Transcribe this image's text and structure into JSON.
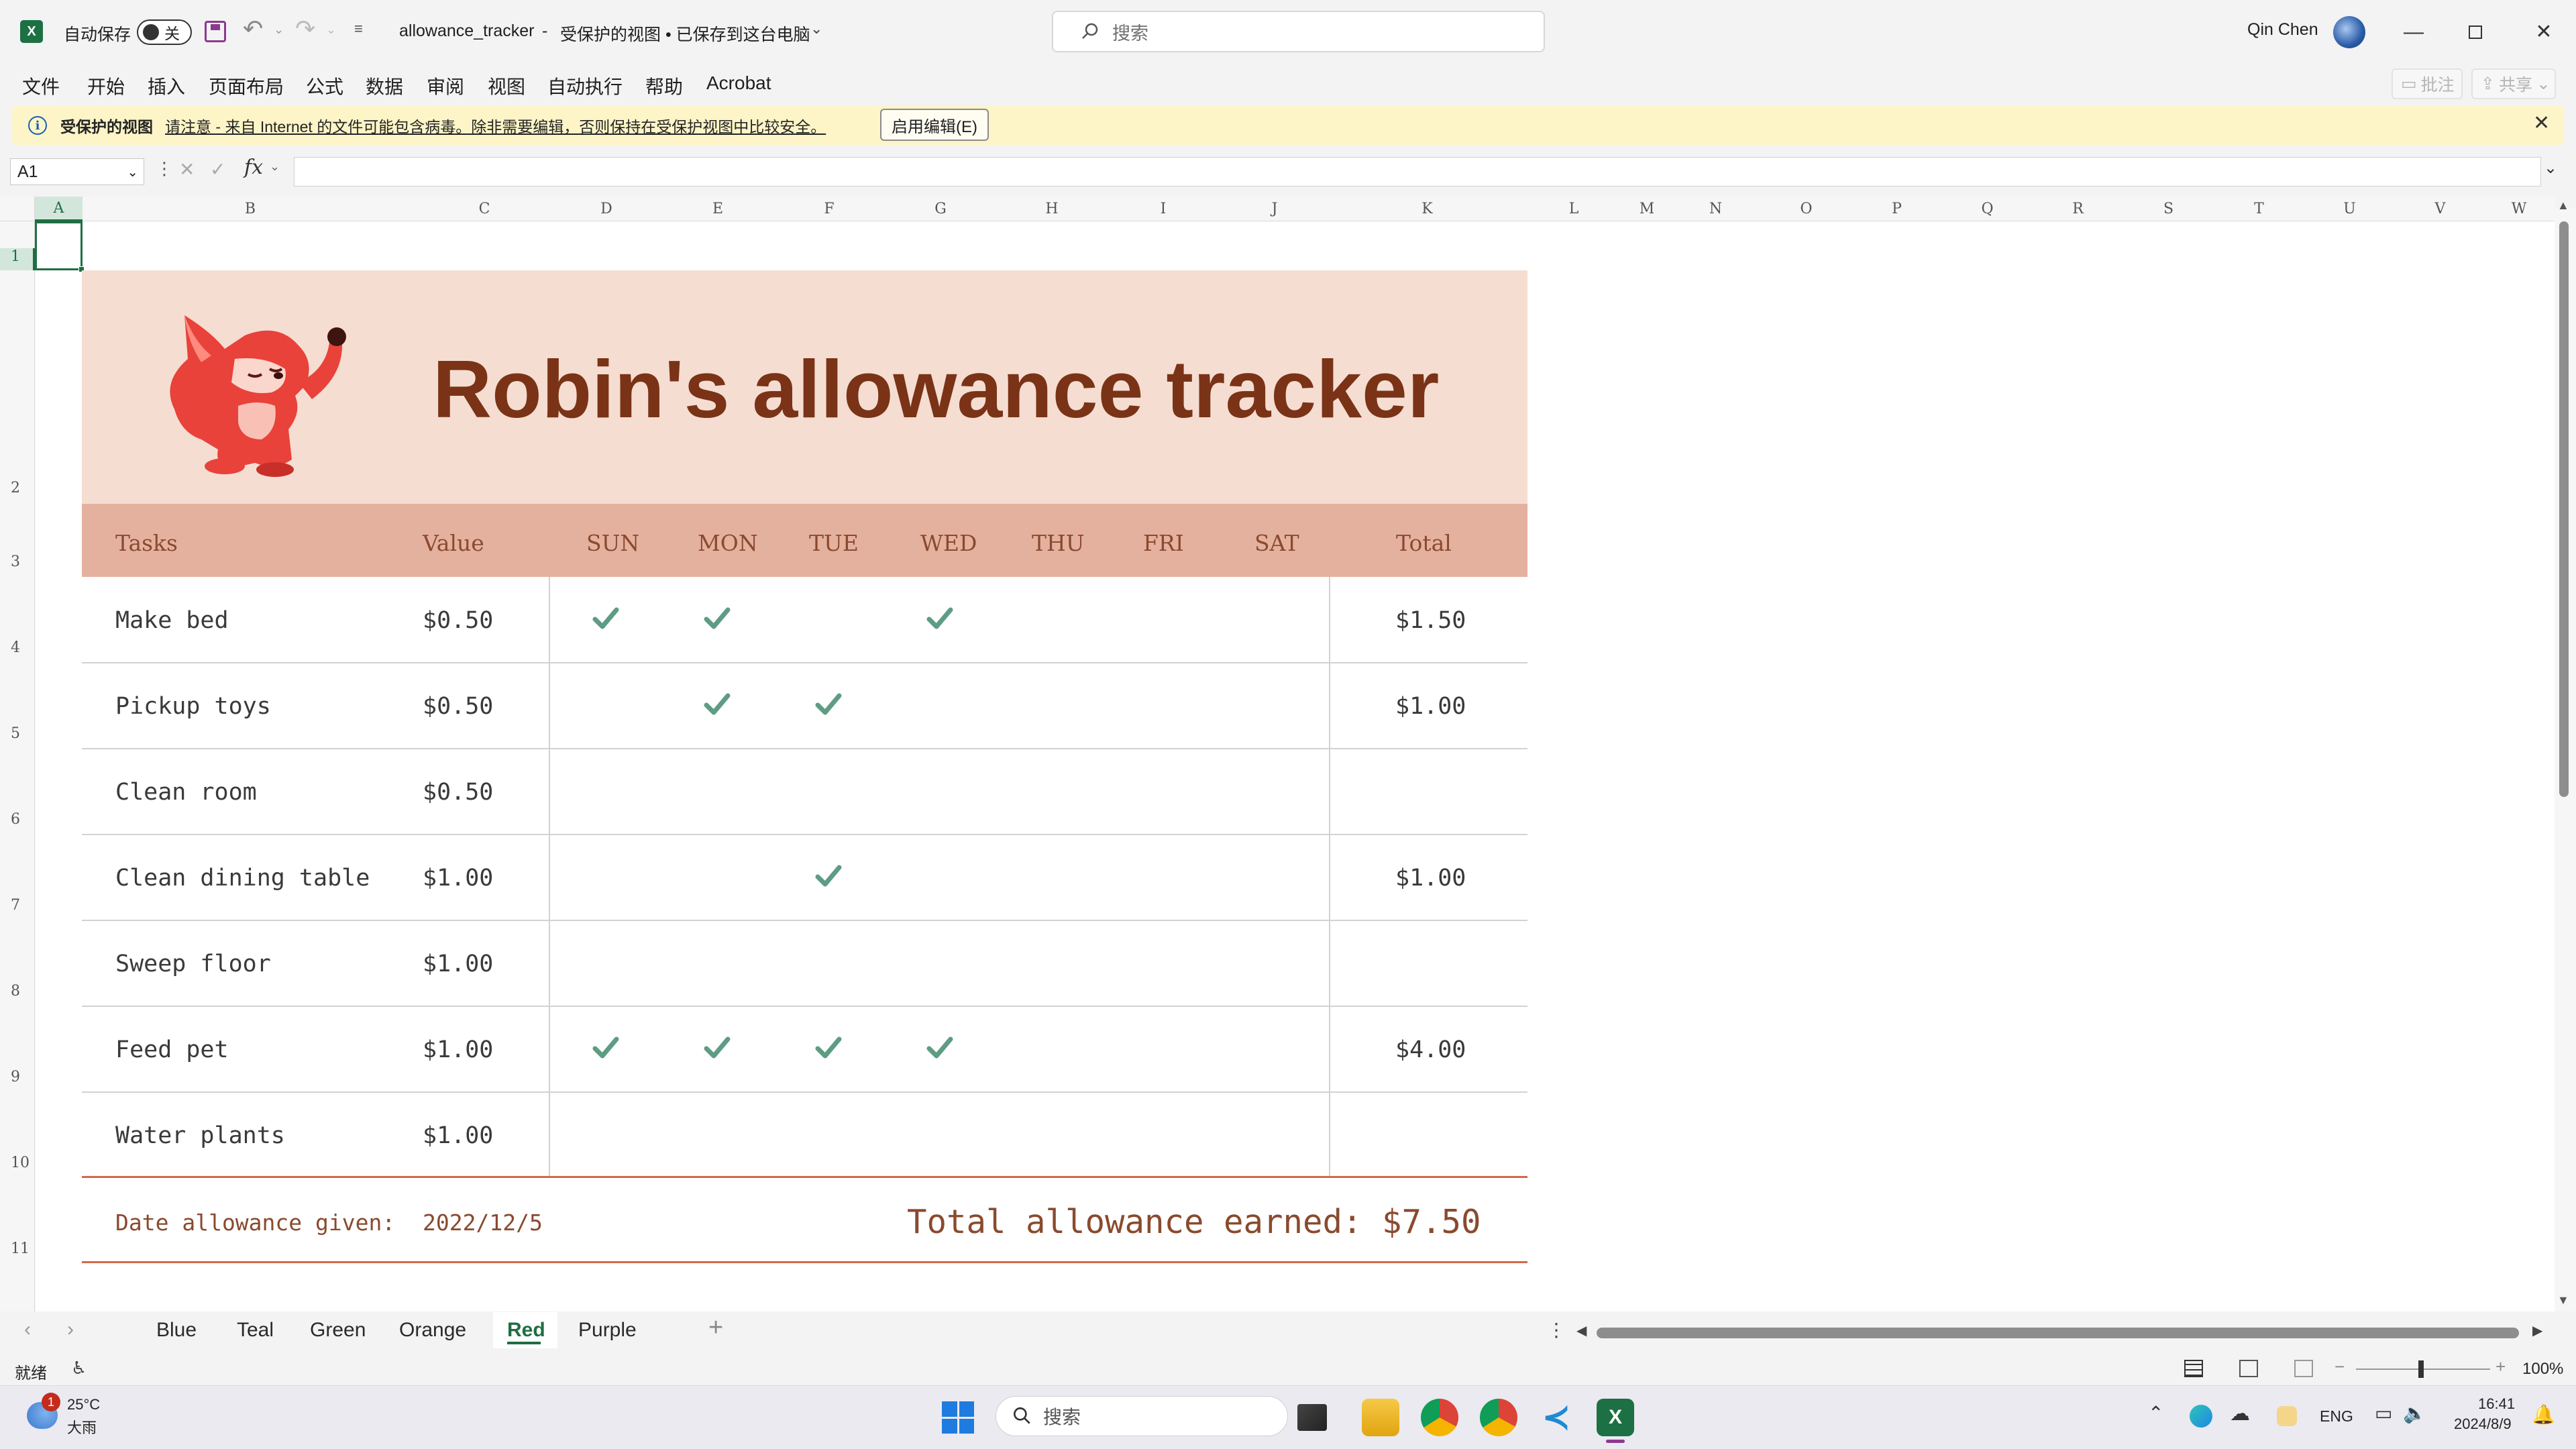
{
  "titlebar": {
    "autosave_label": "自动保存",
    "autosave_state": "关",
    "filename": "allowance_tracker",
    "status": "受保护的视图 • 已保存到这台电脑",
    "search_placeholder": "搜索",
    "user": "Qin Chen"
  },
  "menu": [
    "文件",
    "开始",
    "插入",
    "页面布局",
    "公式",
    "数据",
    "审阅",
    "视图",
    "自动执行",
    "帮助",
    "Acrobat"
  ],
  "ribbon_right": {
    "comments": "批注",
    "share": "共享"
  },
  "protected_bar": {
    "title": "受保护的视图",
    "message": "请注意 - 来自 Internet 的文件可能包含病毒。除非需要编辑，否则保持在受保护视图中比较安全。",
    "button": "启用编辑(E)"
  },
  "formula_bar": {
    "cell_ref": "A1",
    "fx": "fx",
    "value": ""
  },
  "columns": [
    "A",
    "B",
    "C",
    "D",
    "E",
    "F",
    "G",
    "H",
    "I",
    "J",
    "K",
    "L",
    "M",
    "N",
    "O",
    "P",
    "Q",
    "R",
    "S",
    "T",
    "U",
    "V",
    "W"
  ],
  "rows": [
    "1",
    "2",
    "3",
    "4",
    "5",
    "6",
    "7",
    "8",
    "9",
    "10",
    "11"
  ],
  "tracker": {
    "title": "Robin's allowance tracker",
    "headers": {
      "tasks": "Tasks",
      "value": "Value",
      "sun": "SUN",
      "mon": "MON",
      "tue": "TUE",
      "wed": "WED",
      "thu": "THU",
      "fri": "FRI",
      "sat": "SAT",
      "total": "Total"
    },
    "tasks": [
      {
        "name": "Make bed",
        "value": "$0.50",
        "checks": [
          true,
          true,
          false,
          true,
          false,
          false,
          false
        ],
        "total": "$1.50"
      },
      {
        "name": "Pickup toys",
        "value": "$0.50",
        "checks": [
          false,
          true,
          true,
          false,
          false,
          false,
          false
        ],
        "total": "$1.00"
      },
      {
        "name": "Clean room",
        "value": "$0.50",
        "checks": [
          false,
          false,
          false,
          false,
          false,
          false,
          false
        ],
        "total": ""
      },
      {
        "name": "Clean dining table",
        "value": "$1.00",
        "checks": [
          false,
          false,
          true,
          false,
          false,
          false,
          false
        ],
        "total": "$1.00"
      },
      {
        "name": "Sweep floor",
        "value": "$1.00",
        "checks": [
          false,
          false,
          false,
          false,
          false,
          false,
          false
        ],
        "total": ""
      },
      {
        "name": "Feed pet",
        "value": "$1.00",
        "checks": [
          true,
          true,
          true,
          true,
          false,
          false,
          false
        ],
        "total": "$4.00"
      },
      {
        "name": "Water plants",
        "value": "$1.00",
        "checks": [
          false,
          false,
          false,
          false,
          false,
          false,
          false
        ],
        "total": ""
      }
    ],
    "footer": {
      "date_label": "Date allowance given:",
      "date": "2022/12/5",
      "total_label": "Total allowance earned:",
      "total": "$7.50"
    },
    "colors": {
      "banner": "#f5ddd2",
      "header": "#e5b19f",
      "title": "#7a3316",
      "check": "#5e9c84",
      "accent_line": "#d06a4a"
    }
  },
  "sheet_tabs": [
    "Blue",
    "Teal",
    "Green",
    "Orange",
    "Red",
    "Purple"
  ],
  "active_tab": "Red",
  "statusbar": {
    "ready": "就绪",
    "zoom": "100%"
  },
  "taskbar": {
    "weather_temp": "25°C",
    "weather_desc": "大雨",
    "weather_badge": "1",
    "search_placeholder": "搜索",
    "lang": "ENG",
    "time": "16:41",
    "date": "2024/8/9"
  }
}
